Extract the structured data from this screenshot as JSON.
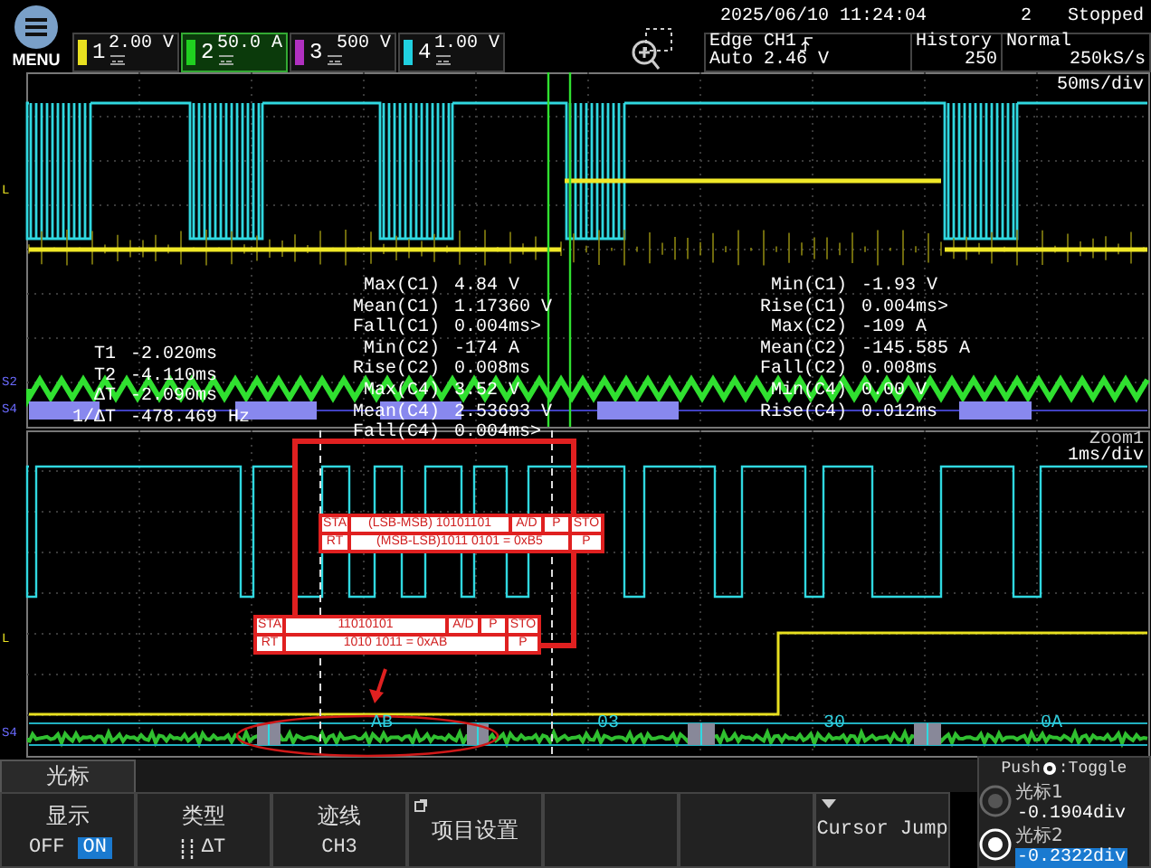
{
  "menu_button": {
    "label": "MENU"
  },
  "channels": [
    {
      "number": "1",
      "scale": "2.00 V",
      "color": "#e8e020",
      "selected": false
    },
    {
      "number": "2",
      "scale": "50.0 A",
      "color": "#20d020",
      "selected": true
    },
    {
      "number": "3",
      "scale": "500 V",
      "color": "#b030c0",
      "selected": false
    },
    {
      "number": "4",
      "scale": "1.00 V",
      "color": "#20d0e0",
      "selected": false
    }
  ],
  "status": {
    "datetime": "2025/06/10 11:24:04",
    "count": "2",
    "state": "Stopped"
  },
  "trigger": {
    "type": "Edge CH1",
    "mode": "Auto 2.46 V"
  },
  "history": {
    "label": "History",
    "value": "250"
  },
  "acquisition": {
    "mode": "Normal",
    "rate": "250kS/s"
  },
  "main_window": {
    "timebase": "50ms/div",
    "trace_labels": [
      {
        "text": "L",
        "color": "#e8e020"
      },
      {
        "text": "S2",
        "color": "#6a6aff"
      },
      {
        "text": "S4",
        "color": "#6a6aff"
      }
    ],
    "measurements_left": [
      {
        "label": "Max(C1)",
        "value": "4.84 V"
      },
      {
        "label": "Mean(C1)",
        "value": "1.17360 V"
      },
      {
        "label": "Fall(C1)",
        "value": "0.004ms>"
      },
      {
        "label": "Min(C2)",
        "value": "-174 A"
      },
      {
        "label": "Rise(C2)",
        "value": "0.008ms"
      },
      {
        "label": "Max(C4)",
        "value": "3.52 V"
      },
      {
        "label": "Mean(C4)",
        "value": "2.53693 V"
      },
      {
        "label": "Fall(C4)",
        "value": "0.004ms>"
      }
    ],
    "measurements_right": [
      {
        "label": "Min(C1)",
        "value": "-1.93 V"
      },
      {
        "label": "Rise(C1)",
        "value": "0.004ms>"
      },
      {
        "label": "Max(C2)",
        "value": "-109 A"
      },
      {
        "label": "Mean(C2)",
        "value": "-145.585 A"
      },
      {
        "label": "Fall(C2)",
        "value": "0.008ms"
      },
      {
        "label": "Min(C4)",
        "value": "0.00 V"
      },
      {
        "label": "Rise(C4)",
        "value": "0.012ms"
      }
    ],
    "cursor_readouts": [
      {
        "label": "T1",
        "value": "-2.020ms"
      },
      {
        "label": "T2",
        "value": "-4.110ms"
      },
      {
        "label": "ΔT",
        "value": "-2.090ms"
      },
      {
        "label": "1/ΔT",
        "value": "-478.469 Hz"
      }
    ]
  },
  "zoom_window": {
    "title": "Zoom1",
    "timebase": "1ms/div",
    "trace_labels": [
      {
        "text": "L",
        "color": "#e8e020"
      },
      {
        "text": "S4",
        "color": "#6a6aff"
      }
    ],
    "decode_tables": [
      {
        "rows": [
          [
            {
              "text": "STA"
            },
            {
              "text": "(LSB-MSB) 10101101"
            },
            {
              "text": "A/D"
            },
            {
              "text": "P"
            },
            {
              "text": "STO"
            }
          ],
          [
            {
              "text": "RT"
            },
            {
              "text": "(MSB-LSB)1011 0101 = 0xB5"
            },
            {
              "text": ""
            },
            {
              "text": ""
            },
            {
              "text": "P"
            }
          ]
        ]
      },
      {
        "rows": [
          [
            {
              "text": "STA"
            },
            {
              "text": "11010101"
            },
            {
              "text": "A/D"
            },
            {
              "text": "P"
            },
            {
              "text": "STO"
            }
          ],
          [
            {
              "text": "RT"
            },
            {
              "text": "1010 1011 = 0xAB"
            },
            {
              "text": ""
            },
            {
              "text": ""
            },
            {
              "text": "P"
            }
          ]
        ]
      }
    ],
    "bus_values": [
      "AB",
      "03",
      "30",
      "0A"
    ]
  },
  "menu_tab": {
    "label": "光标"
  },
  "softkeys": [
    {
      "kind": "toggle",
      "label": "显示",
      "options": [
        {
          "label": "OFF",
          "selected": false
        },
        {
          "label": "ON",
          "selected": true
        }
      ]
    },
    {
      "kind": "type",
      "label": "类型",
      "value": "ΔT"
    },
    {
      "kind": "select",
      "label": "迹线",
      "value": "CH3"
    },
    {
      "kind": "submenu",
      "label": "项目设置"
    },
    {
      "kind": "blank"
    },
    {
      "kind": "blank"
    },
    {
      "kind": "dropdown",
      "label": "Cursor Jump"
    }
  ],
  "cursor_panel": {
    "hint_before": "Push",
    "hint_after": ":Toggle",
    "cursors": [
      {
        "label": "光标1",
        "value": "-0.1904div",
        "selected": false
      },
      {
        "label": "光标2",
        "value": "-0.2322div",
        "selected": true
      }
    ]
  }
}
